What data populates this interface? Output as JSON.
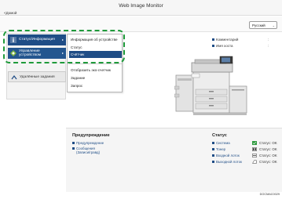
{
  "app": {
    "title": "Web Image Monitor",
    "home_link": "<Домой"
  },
  "header": {
    "language": "Русский"
  },
  "left_menu": {
    "status_info": "Статус/Информация",
    "manage_device": "Управление\nустройством",
    "remote_item": "Удалённые задания"
  },
  "submenu": {
    "device_info": "Информация об устройстве",
    "status": "Статус",
    "counter": "Счётчик",
    "eco_counter": "Отобразить эко-счетчик",
    "job": "Задание",
    "query": "Запрос"
  },
  "device_info": {
    "comment_label": "Комментарий",
    "location_label": "Имя хоста",
    "comment_value": ":",
    "location_value": ":"
  },
  "warnings": {
    "title": "Предупреждение",
    "items": [
      "Предупреждение",
      "Сообщения\n(Записи/гравд)"
    ]
  },
  "status_section": {
    "title": "Статус",
    "items": [
      "Система",
      "Тонер",
      "Входной лоток",
      "Выходной лоток"
    ],
    "values": [
      "Статус: OK",
      "Статус: OK",
      "Статус: OK",
      "Статус: OK"
    ]
  },
  "figure_code": "DOCMAC0029",
  "colors": {
    "accent": "#1f4d86",
    "highlight": "#1e9a3a",
    "status_ok": "#2e9a3e"
  },
  "icons": {
    "status_info": "info-icon",
    "manage_device": "device-manage-icon",
    "remote_item": "remote-job-icon",
    "status_toner": "toner-icon",
    "status_tray": "tray-icon"
  }
}
